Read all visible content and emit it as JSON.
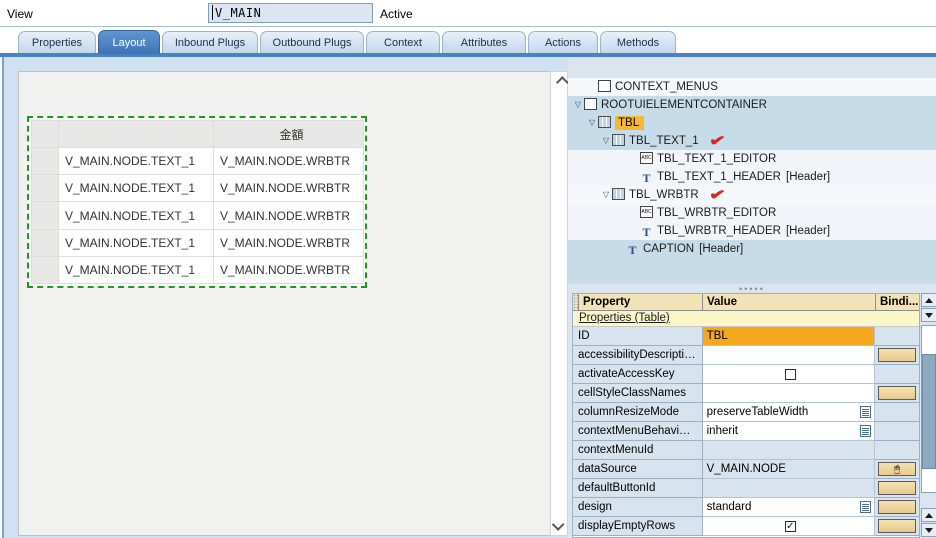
{
  "topbar": {
    "label": "View",
    "view_name": "V_MAIN",
    "status": "Active"
  },
  "tabs": [
    {
      "label": "Properties",
      "active": false
    },
    {
      "label": "Layout",
      "active": true
    },
    {
      "label": "Inbound Plugs",
      "active": false
    },
    {
      "label": "Outbound Plugs",
      "active": false
    },
    {
      "label": "Context",
      "active": false
    },
    {
      "label": "Attributes",
      "active": false
    },
    {
      "label": "Actions",
      "active": false
    },
    {
      "label": "Methods",
      "active": false
    }
  ],
  "canvas": {
    "preview_table": {
      "headers": [
        "",
        "金額"
      ],
      "rows": [
        [
          "V_MAIN.NODE.TEXT_1",
          "V_MAIN.NODE.WRBTR"
        ],
        [
          "V_MAIN.NODE.TEXT_1",
          "V_MAIN.NODE.WRBTR"
        ],
        [
          "V_MAIN.NODE.TEXT_1",
          "V_MAIN.NODE.WRBTR"
        ],
        [
          "V_MAIN.NODE.TEXT_1",
          "V_MAIN.NODE.WRBTR"
        ],
        [
          "V_MAIN.NODE.TEXT_1",
          "V_MAIN.NODE.WRBTR"
        ]
      ]
    },
    "scroll_up_icon": "chevron-up-icon",
    "scroll_down_icon": "chevron-down-icon"
  },
  "tree": {
    "nodes": [
      {
        "label": "CONTEXT_MENUS",
        "tag": "",
        "depth": 1,
        "twisty": "",
        "icon": "checkbox-blank-icon",
        "selected": false,
        "tick": false
      },
      {
        "label": "ROOTUIELEMENTCONTAINER",
        "tag": "",
        "depth": 0,
        "twisty": "▽",
        "icon": "checkbox-blank-icon",
        "selected": false,
        "tick": false
      },
      {
        "label": "TBL",
        "tag": "",
        "depth": 1,
        "twisty": "▽",
        "icon": "table-icon",
        "selected": true,
        "tick": false
      },
      {
        "label": "TBL_TEXT_1",
        "tag": "",
        "depth": 2,
        "twisty": "▽",
        "icon": "table-icon",
        "selected": false,
        "tick": true
      },
      {
        "label": "TBL_TEXT_1_EDITOR",
        "tag": "",
        "depth": 4,
        "twisty": "",
        "icon": "abc-editor-icon",
        "selected": false,
        "tick": false
      },
      {
        "label": "TBL_TEXT_1_HEADER",
        "tag": "[Header]",
        "depth": 4,
        "twisty": "",
        "icon": "text-t-icon",
        "selected": false,
        "tick": false
      },
      {
        "label": "TBL_WRBTR",
        "tag": "",
        "depth": 2,
        "twisty": "▽",
        "icon": "table-icon",
        "selected": false,
        "tick": true
      },
      {
        "label": "TBL_WRBTR_EDITOR",
        "tag": "",
        "depth": 4,
        "twisty": "",
        "icon": "abc-editor-icon",
        "selected": false,
        "tick": false
      },
      {
        "label": "TBL_WRBTR_HEADER",
        "tag": "[Header]",
        "depth": 4,
        "twisty": "",
        "icon": "text-t-icon",
        "selected": false,
        "tick": false
      },
      {
        "label": "CAPTION",
        "tag": "[Header]",
        "depth": 3,
        "twisty": "",
        "icon": "text-t-icon",
        "selected": false,
        "tick": false
      }
    ]
  },
  "properties": {
    "columns": [
      "Property",
      "Value",
      "Bindi..."
    ],
    "section": "Properties (Table)",
    "rows": [
      {
        "name": "ID",
        "value": "TBL",
        "kind": "gold",
        "binding": false
      },
      {
        "name": "accessibilityDescripti…",
        "value": "",
        "kind": "text",
        "binding": true
      },
      {
        "name": "activateAccessKey",
        "value": "",
        "kind": "checkbox",
        "checked": false,
        "binding": false
      },
      {
        "name": "cellStyleClassNames",
        "value": "",
        "kind": "text",
        "binding": true
      },
      {
        "name": "columnResizeMode",
        "value": "preserveTableWidth",
        "kind": "dropdown",
        "binding": false
      },
      {
        "name": "contextMenuBehavi…",
        "value": "inherit",
        "kind": "dropdown",
        "binding": false
      },
      {
        "name": "contextMenuId",
        "value": "",
        "kind": "readonly",
        "binding": false
      },
      {
        "name": "dataSource",
        "value": "V_MAIN.NODE",
        "kind": "readonly",
        "binding": true,
        "binding_icon": "binding-link-icon"
      },
      {
        "name": "defaultButtonId",
        "value": "",
        "kind": "readonly",
        "binding": true
      },
      {
        "name": "design",
        "value": "standard",
        "kind": "dropdown",
        "binding": true
      },
      {
        "name": "displayEmptyRows",
        "value": "",
        "kind": "checkbox",
        "checked": true,
        "binding": true
      }
    ]
  },
  "scrollbars": {
    "up_arrow": "▲",
    "down_arrow": "▼"
  }
}
